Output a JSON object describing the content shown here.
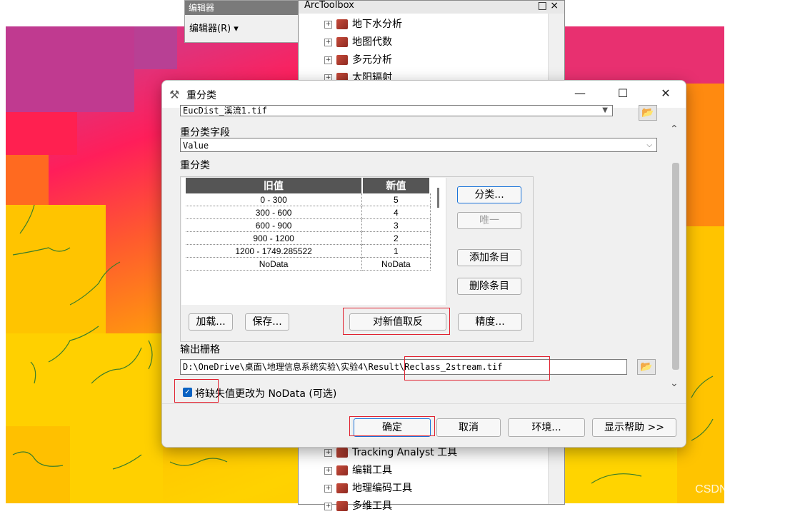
{
  "editor_toolbar": {
    "title": "编辑器",
    "menu_label": "编辑器(R) ▾"
  },
  "arctoolbox": {
    "title": "ArcToolbox",
    "window_controls": "□ ×",
    "top_items": [
      "地下水分析",
      "地图代数",
      "多元分析",
      "太阳辐射"
    ],
    "bottom_items": [
      "Tracking Analyst 工具",
      "编辑工具",
      "地理编码工具",
      "多维工具"
    ]
  },
  "dialog": {
    "title": "重分类",
    "input_raster_value": "EucDist_溪流1.tif",
    "reclass_field_label": "重分类字段",
    "reclass_field_value": "Value",
    "reclass_label": "重分类",
    "table": {
      "headers": [
        "旧值",
        "新值"
      ],
      "rows": [
        [
          "0 - 300",
          "5"
        ],
        [
          "300 - 600",
          "4"
        ],
        [
          "600 - 900",
          "3"
        ],
        [
          "900 - 1200",
          "2"
        ],
        [
          "1200 - 1749.285522",
          "1"
        ],
        [
          "NoData",
          "NoData"
        ]
      ]
    },
    "buttons": {
      "classify": "分类...",
      "unique": "唯一",
      "add_entry": "添加条目",
      "delete_entry": "删除条目",
      "load": "加载...",
      "save": "保存...",
      "reverse": "对新值取反",
      "precision": "精度..."
    },
    "output_label": "输出栅格",
    "output_value": "D:\\OneDrive\\桌面\\地理信息系统实验\\实验4\\Result\\Reclass_2stream.tif",
    "checkbox_label": "将缺失值更改为 NoData (可选)",
    "footer": {
      "ok": "确定",
      "cancel": "取消",
      "env": "环境...",
      "help": "显示帮助 >>"
    }
  },
  "watermark": "CSDN @Edward-tan",
  "colors": {
    "map_pink": "#e0327a",
    "map_orange": "#ff9c0c",
    "map_yellow": "#ffd200",
    "highlight_red": "#e0202e",
    "accent_blue": "#1a73d9"
  }
}
